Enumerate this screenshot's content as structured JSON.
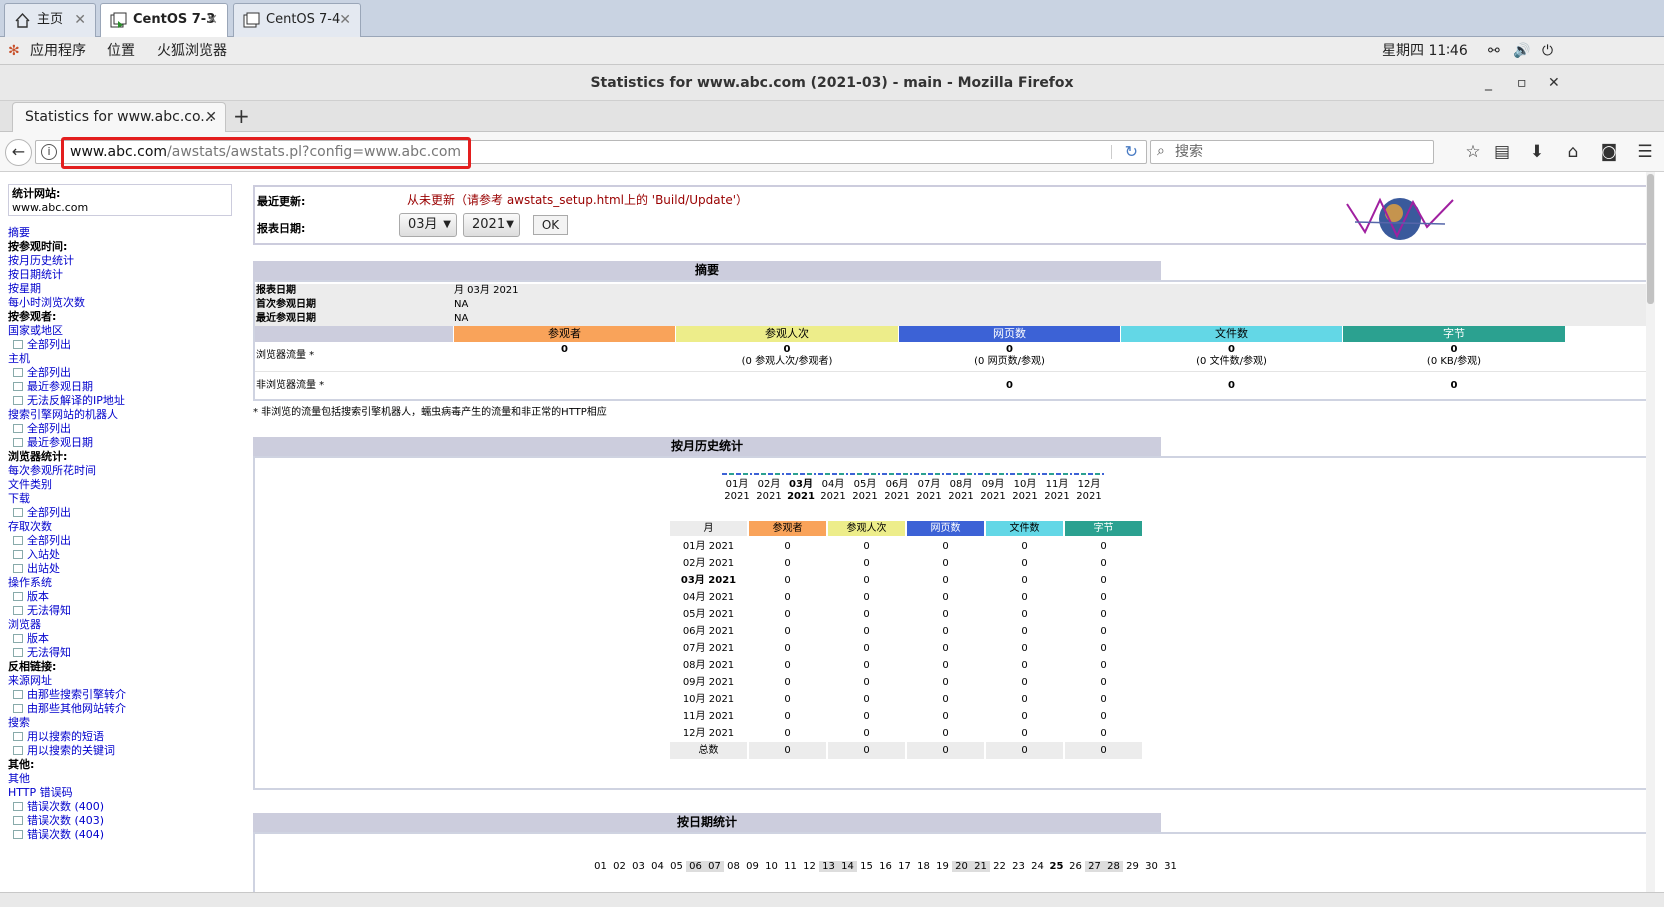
{
  "vm_tabs": [
    {
      "label": "主页",
      "icon": "home-icon"
    },
    {
      "label": "CentOS 7-3",
      "icon": "vm-icon"
    },
    {
      "label": "CentOS 7-4",
      "icon": "vm-icon"
    }
  ],
  "gnome": {
    "apps": "应用程序",
    "places": "位置",
    "firefox": "火狐浏览器",
    "clock": "星期四 11∶46"
  },
  "window": {
    "title": "Statistics for www.abc.com (2021-03) - main - Mozilla Firefox"
  },
  "browser": {
    "tab_title": "Statistics for www.abc.co...",
    "url_domain": "www.abc.com",
    "url_path": "/awstats/awstats.pl?config=www.abc.com",
    "search_placeholder": "搜索"
  },
  "sidebar": {
    "site_label": "统计网站:",
    "site_value": "www.abc.com",
    "items": [
      {
        "text": "摘要",
        "type": "link"
      },
      {
        "text": "按参观时间:",
        "type": "heading"
      },
      {
        "text": "按月历史统计",
        "type": "link"
      },
      {
        "text": "按日期统计",
        "type": "link"
      },
      {
        "text": "按星期",
        "type": "link"
      },
      {
        "text": "每小时浏览次数",
        "type": "link"
      },
      {
        "text": "按参观者:",
        "type": "heading"
      },
      {
        "text": "国家或地区",
        "type": "link"
      },
      {
        "text": "全部列出",
        "type": "sub"
      },
      {
        "text": "主机",
        "type": "link"
      },
      {
        "text": "全部列出",
        "type": "sub"
      },
      {
        "text": "最近参观日期",
        "type": "sub"
      },
      {
        "text": "无法反解译的IP地址",
        "type": "sub"
      },
      {
        "text": "搜索引擎网站的机器人",
        "type": "link"
      },
      {
        "text": "全部列出",
        "type": "sub"
      },
      {
        "text": "最近参观日期",
        "type": "sub"
      },
      {
        "text": "浏览器统计:",
        "type": "heading"
      },
      {
        "text": "每次参观所花时间",
        "type": "link"
      },
      {
        "text": "文件类别",
        "type": "link"
      },
      {
        "text": "下载",
        "type": "link"
      },
      {
        "text": "全部列出",
        "type": "sub"
      },
      {
        "text": "存取次数",
        "type": "link"
      },
      {
        "text": "全部列出",
        "type": "sub"
      },
      {
        "text": "入站处",
        "type": "sub"
      },
      {
        "text": "出站处",
        "type": "sub"
      },
      {
        "text": "操作系统",
        "type": "link"
      },
      {
        "text": "版本",
        "type": "sub"
      },
      {
        "text": "无法得知",
        "type": "sub"
      },
      {
        "text": "浏览器",
        "type": "link"
      },
      {
        "text": "版本",
        "type": "sub"
      },
      {
        "text": "无法得知",
        "type": "sub"
      },
      {
        "text": "反相链接:",
        "type": "heading"
      },
      {
        "text": "来源网址",
        "type": "link"
      },
      {
        "text": "由那些搜索引擎转介",
        "type": "sub"
      },
      {
        "text": "由那些其他网站转介",
        "type": "sub"
      },
      {
        "text": "搜索",
        "type": "link"
      },
      {
        "text": "用以搜索的短语",
        "type": "sub"
      },
      {
        "text": "用以搜索的关键词",
        "type": "sub"
      },
      {
        "text": "其他:",
        "type": "heading"
      },
      {
        "text": "其他",
        "type": "link"
      },
      {
        "text": "HTTP 错误码",
        "type": "link"
      },
      {
        "text": "错误次数 (400)",
        "type": "sub"
      },
      {
        "text": "错误次数 (403)",
        "type": "sub"
      },
      {
        "text": "错误次数 (404)",
        "type": "sub"
      }
    ]
  },
  "top": {
    "last_update_label": "最近更新:",
    "last_update_value": "从未更新（请参考 awstats_setup.html上的 'Build/Update'）",
    "report_date_label": "报表日期:",
    "month_select": "03月",
    "year_select": "2021",
    "ok": "OK"
  },
  "summary": {
    "title": "摘要",
    "rows": [
      {
        "k": "报表日期",
        "v": "月 03月 2021"
      },
      {
        "k": "首次参观日期",
        "v": "NA"
      },
      {
        "k": "最近参观日期",
        "v": "NA"
      }
    ],
    "cols": [
      "参观者",
      "参观人次",
      "网页数",
      "文件数",
      "字节"
    ],
    "browser_label": "浏览器流量 *",
    "browser_values": [
      "0",
      "0",
      "0",
      "0",
      "0"
    ],
    "browser_subs": [
      "",
      "(0 参观人次/参观者)",
      "(0 网页数/参观)",
      "(0 文件数/参观)",
      "(0 KB/参观)"
    ],
    "nonbrowser_label": "非浏览器流量 *",
    "nonbrowser_values": [
      "0",
      "0",
      "0"
    ],
    "footnote": "* 非浏览的流量包括搜索引擎机器人，蠕虫病毒产生的流量和非正常的HTTP相应"
  },
  "monthly": {
    "title": "按月历史统计",
    "months": [
      "01月",
      "02月",
      "03月",
      "04月",
      "05月",
      "06月",
      "07月",
      "08月",
      "09月",
      "10月",
      "11月",
      "12月"
    ],
    "year": "2021",
    "table_headers": [
      "月",
      "参观者",
      "参观人次",
      "网页数",
      "文件数",
      "字节"
    ],
    "rows": [
      [
        "01月 2021",
        "0",
        "0",
        "0",
        "0",
        "0"
      ],
      [
        "02月 2021",
        "0",
        "0",
        "0",
        "0",
        "0"
      ],
      [
        "03月 2021",
        "0",
        "0",
        "0",
        "0",
        "0"
      ],
      [
        "04月 2021",
        "0",
        "0",
        "0",
        "0",
        "0"
      ],
      [
        "05月 2021",
        "0",
        "0",
        "0",
        "0",
        "0"
      ],
      [
        "06月 2021",
        "0",
        "0",
        "0",
        "0",
        "0"
      ],
      [
        "07月 2021",
        "0",
        "0",
        "0",
        "0",
        "0"
      ],
      [
        "08月 2021",
        "0",
        "0",
        "0",
        "0",
        "0"
      ],
      [
        "09月 2021",
        "0",
        "0",
        "0",
        "0",
        "0"
      ],
      [
        "10月 2021",
        "0",
        "0",
        "0",
        "0",
        "0"
      ],
      [
        "11月 2021",
        "0",
        "0",
        "0",
        "0",
        "0"
      ],
      [
        "12月 2021",
        "0",
        "0",
        "0",
        "0",
        "0"
      ],
      [
        "总数",
        "0",
        "0",
        "0",
        "0",
        "0"
      ]
    ]
  },
  "daily": {
    "title": "按日期统计",
    "days": [
      "01",
      "02",
      "03",
      "04",
      "05",
      "06",
      "07",
      "08",
      "09",
      "10",
      "11",
      "12",
      "13",
      "14",
      "15",
      "16",
      "17",
      "18",
      "19",
      "20",
      "21",
      "22",
      "23",
      "24",
      "25",
      "26",
      "27",
      "28",
      "29",
      "30",
      "31"
    ]
  },
  "colors": {
    "visitors": "#f9a35a",
    "visits": "#eded8a",
    "pages": "#3c62d6",
    "files": "#63d7e6",
    "bytes": "#2ba190",
    "highlight": "#e31e1e"
  }
}
